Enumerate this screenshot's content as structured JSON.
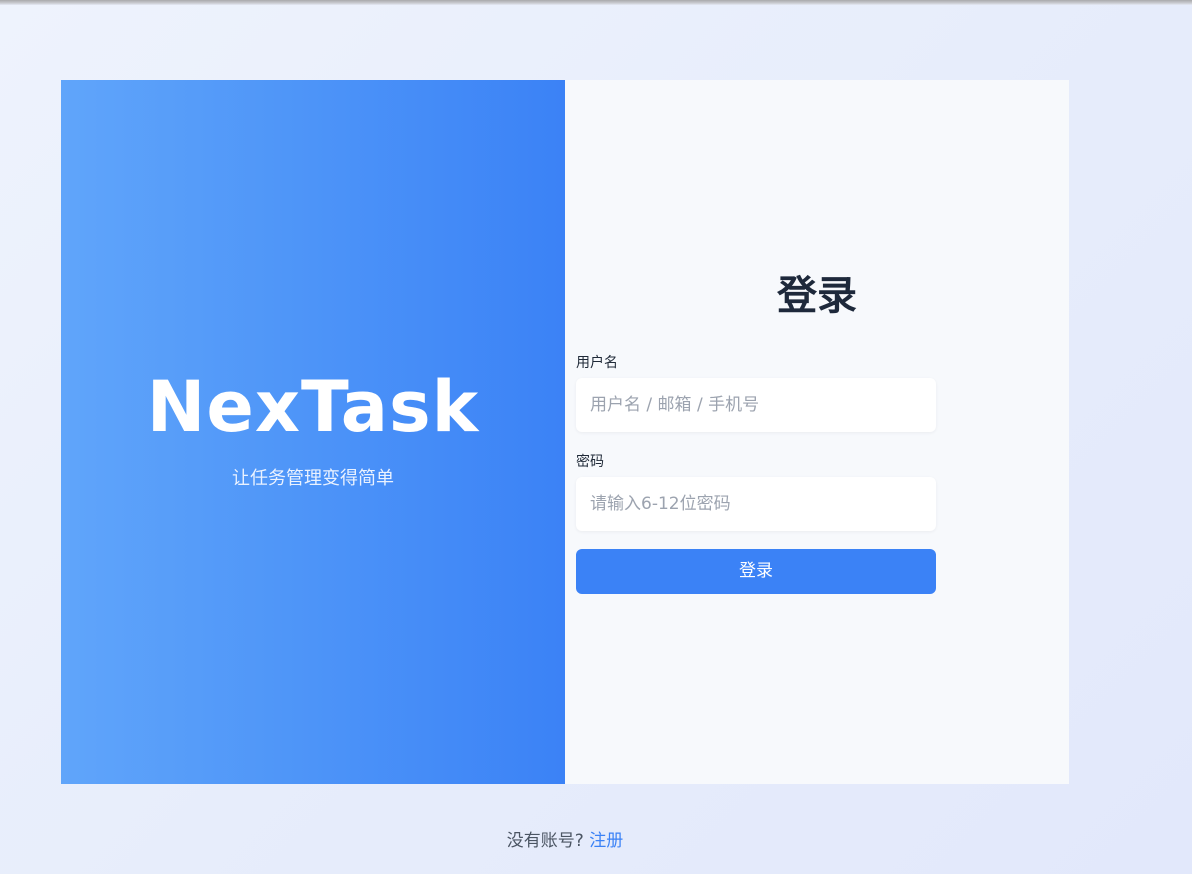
{
  "brand": {
    "name": "NexTask",
    "tagline": "让任务管理变得简单"
  },
  "login_form": {
    "title": "登录",
    "username": {
      "label": "用户名",
      "value": "",
      "placeholder": "用户名 / 邮箱 / 手机号"
    },
    "password": {
      "label": "密码",
      "value": "",
      "placeholder": "请输入6-12位密码"
    },
    "submit_label": "登录"
  },
  "footer": {
    "prompt": "没有账号?",
    "register_link": "注册"
  },
  "colors": {
    "brand_gradient_start": "#60a5fa",
    "brand_gradient_end": "#3b82f6",
    "primary_button": "#3b82f6",
    "link": "#3b82f6",
    "title_text": "#1e293b"
  }
}
